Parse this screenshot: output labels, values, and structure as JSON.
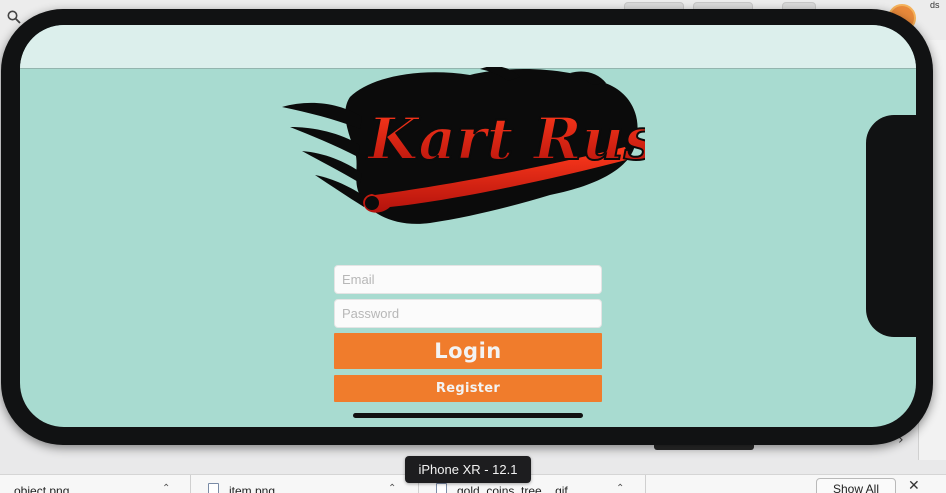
{
  "desktop": {
    "corner_text": "ds"
  },
  "simulator": {
    "device_label": "iPhone XR - 12.1"
  },
  "app": {
    "logo": {
      "text": "Kart Rush",
      "colors": {
        "primary": "#e8231a",
        "flame": "#000000"
      }
    },
    "email": {
      "value": "",
      "placeholder": "Email"
    },
    "password": {
      "value": "",
      "placeholder": "Password"
    },
    "login_label": "Login",
    "register_label": "Register",
    "colors": {
      "background": "#a8dbd0",
      "button": "#f07c2c",
      "button_text": "#f3f3f3"
    }
  },
  "downloads": {
    "items": [
      {
        "name": "...object.png",
        "icon": "file-icon"
      },
      {
        "name": "item.png",
        "icon": "file-icon"
      },
      {
        "name": "gold_coins_tree....gif",
        "icon": "file-icon"
      }
    ],
    "show_all_label": "Show All",
    "close_icon": "close-icon"
  }
}
